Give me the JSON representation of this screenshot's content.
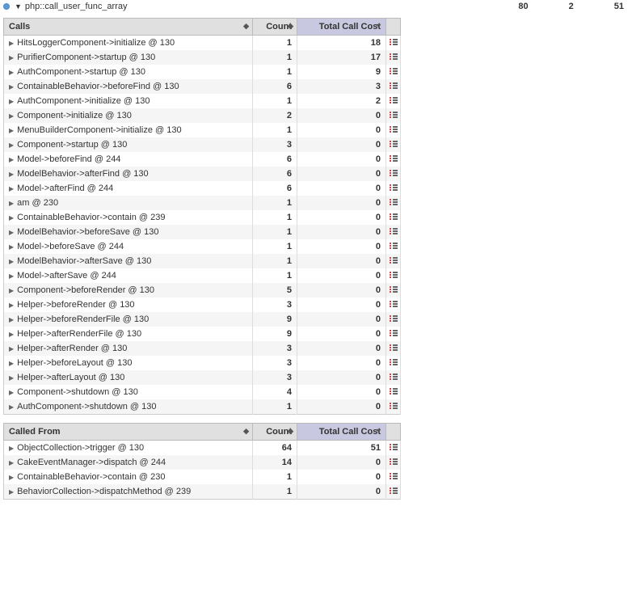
{
  "top": {
    "title": "php::call_user_func_array",
    "val1": "80",
    "val2": "2",
    "val3": "51"
  },
  "calls": {
    "h_name": "Calls",
    "h_count": "Count",
    "h_cost": "Total Call Cost",
    "rows": [
      {
        "n": "HitsLoggerComponent->initialize @ 130",
        "c": "1",
        "t": "18"
      },
      {
        "n": "PurifierComponent->startup @ 130",
        "c": "1",
        "t": "17"
      },
      {
        "n": "AuthComponent->startup @ 130",
        "c": "1",
        "t": "9"
      },
      {
        "n": "ContainableBehavior->beforeFind @ 130",
        "c": "6",
        "t": "3"
      },
      {
        "n": "AuthComponent->initialize @ 130",
        "c": "1",
        "t": "2"
      },
      {
        "n": "Component->initialize @ 130",
        "c": "2",
        "t": "0"
      },
      {
        "n": "MenuBuilderComponent->initialize @ 130",
        "c": "1",
        "t": "0"
      },
      {
        "n": "Component->startup @ 130",
        "c": "3",
        "t": "0"
      },
      {
        "n": "Model->beforeFind @ 244",
        "c": "6",
        "t": "0"
      },
      {
        "n": "ModelBehavior->afterFind @ 130",
        "c": "6",
        "t": "0"
      },
      {
        "n": "Model->afterFind @ 244",
        "c": "6",
        "t": "0"
      },
      {
        "n": "am @ 230",
        "c": "1",
        "t": "0"
      },
      {
        "n": "ContainableBehavior->contain @ 239",
        "c": "1",
        "t": "0"
      },
      {
        "n": "ModelBehavior->beforeSave @ 130",
        "c": "1",
        "t": "0"
      },
      {
        "n": "Model->beforeSave @ 244",
        "c": "1",
        "t": "0"
      },
      {
        "n": "ModelBehavior->afterSave @ 130",
        "c": "1",
        "t": "0"
      },
      {
        "n": "Model->afterSave @ 244",
        "c": "1",
        "t": "0"
      },
      {
        "n": "Component->beforeRender @ 130",
        "c": "5",
        "t": "0"
      },
      {
        "n": "Helper->beforeRender @ 130",
        "c": "3",
        "t": "0"
      },
      {
        "n": "Helper->beforeRenderFile @ 130",
        "c": "9",
        "t": "0"
      },
      {
        "n": "Helper->afterRenderFile @ 130",
        "c": "9",
        "t": "0"
      },
      {
        "n": "Helper->afterRender @ 130",
        "c": "3",
        "t": "0"
      },
      {
        "n": "Helper->beforeLayout @ 130",
        "c": "3",
        "t": "0"
      },
      {
        "n": "Helper->afterLayout @ 130",
        "c": "3",
        "t": "0"
      },
      {
        "n": "Component->shutdown @ 130",
        "c": "4",
        "t": "0"
      },
      {
        "n": "AuthComponent->shutdown @ 130",
        "c": "1",
        "t": "0"
      }
    ]
  },
  "called_from": {
    "h_name": "Called From",
    "h_count": "Count",
    "h_cost": "Total Call Cost",
    "rows": [
      {
        "n": "ObjectCollection->trigger @ 130",
        "c": "64",
        "t": "51"
      },
      {
        "n": "CakeEventManager->dispatch @ 244",
        "c": "14",
        "t": "0"
      },
      {
        "n": "ContainableBehavior->contain @ 230",
        "c": "1",
        "t": "0"
      },
      {
        "n": "BehaviorCollection->dispatchMethod @ 239",
        "c": "1",
        "t": "0"
      }
    ]
  }
}
